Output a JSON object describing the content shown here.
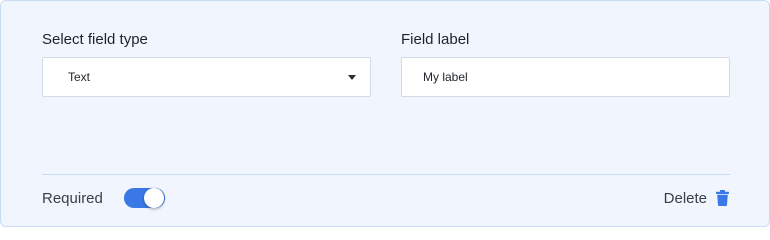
{
  "field_type": {
    "label": "Select field type",
    "selected_value": "Text"
  },
  "field_label": {
    "label": "Field label",
    "value": "My label"
  },
  "footer": {
    "required_label": "Required",
    "required_on": true,
    "delete_label": "Delete"
  },
  "icons": {
    "dropdown": "caret-down-icon",
    "delete": "trash-icon"
  },
  "colors": {
    "accent": "#3b78e7",
    "card_background": "#f1f6fe",
    "border": "#c9dcf5"
  }
}
